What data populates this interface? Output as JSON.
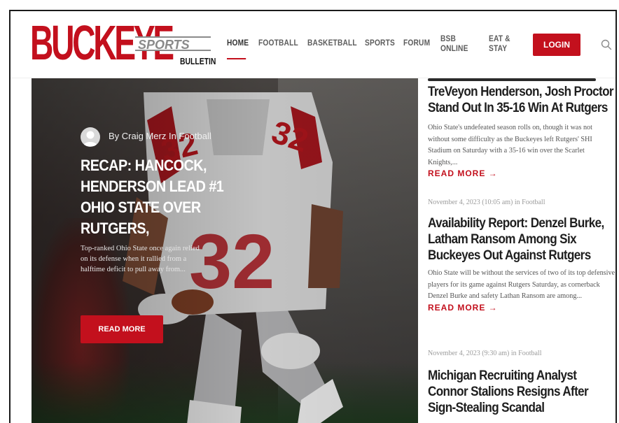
{
  "brand": {
    "logo_main": "BUCKEYE",
    "logo_sports": "SPORTS",
    "logo_bulletin": "BULLETIN",
    "accent_color": "#c3101d"
  },
  "nav": {
    "items": [
      {
        "label": "HOME",
        "active": true
      },
      {
        "label": "FOOTBALL"
      },
      {
        "label": "BASKETBALL"
      },
      {
        "label": "SPORTS"
      },
      {
        "label": "FORUM"
      },
      {
        "label_line1": "BSB",
        "label_line2": "ONLINE"
      },
      {
        "label_line1": "EAT &",
        "label_line2": "STAY"
      }
    ],
    "login_label": "LOGIN",
    "search_icon": "search-icon"
  },
  "hero": {
    "author_prefix": "By",
    "author_name": "Craig Merz",
    "category_prefix": "In",
    "category": "Football",
    "title": "RECAP: HANCOCK, HENDERSON LEAD #1 OHIO STATE OVER RUTGERS,",
    "excerpt": "Top-ranked Ohio State once again relied on its defense when it rallied from a halftime deficit to pull away from...",
    "read_more": "READ MORE",
    "jersey_number": "32"
  },
  "articles": [
    {
      "meta": "",
      "title": "TreVeyon Henderson, Josh Proctor Stand Out In 35-16 Win At Rutgers",
      "excerpt": "Ohio State's undefeated season rolls on, though it was not without some difficulty as the Buckeyes left Rutgers' SHI Stadium on Saturday with a 35-16 win over the Scarlet Knights,...",
      "read_more": "READ MORE →"
    },
    {
      "meta": "November 4, 2023 (10:05 am) in Football",
      "title": "Availability Report: Denzel Burke, Latham Ransom Among Six Buckeyes Out Against Rutgers",
      "excerpt": "Ohio State will be without the services of two of its top defensive players for its game against Rutgers Saturday, as cornerback Denzel Burke and safety Lathan Ransom are among...",
      "read_more": "READ MORE →"
    },
    {
      "meta": "November 4, 2023 (9:30 am) in Football",
      "title": "Michigan Recruiting Analyst Connor Stalions Resigns After Sign-Stealing Scandal",
      "excerpt": "",
      "read_more": ""
    }
  ]
}
